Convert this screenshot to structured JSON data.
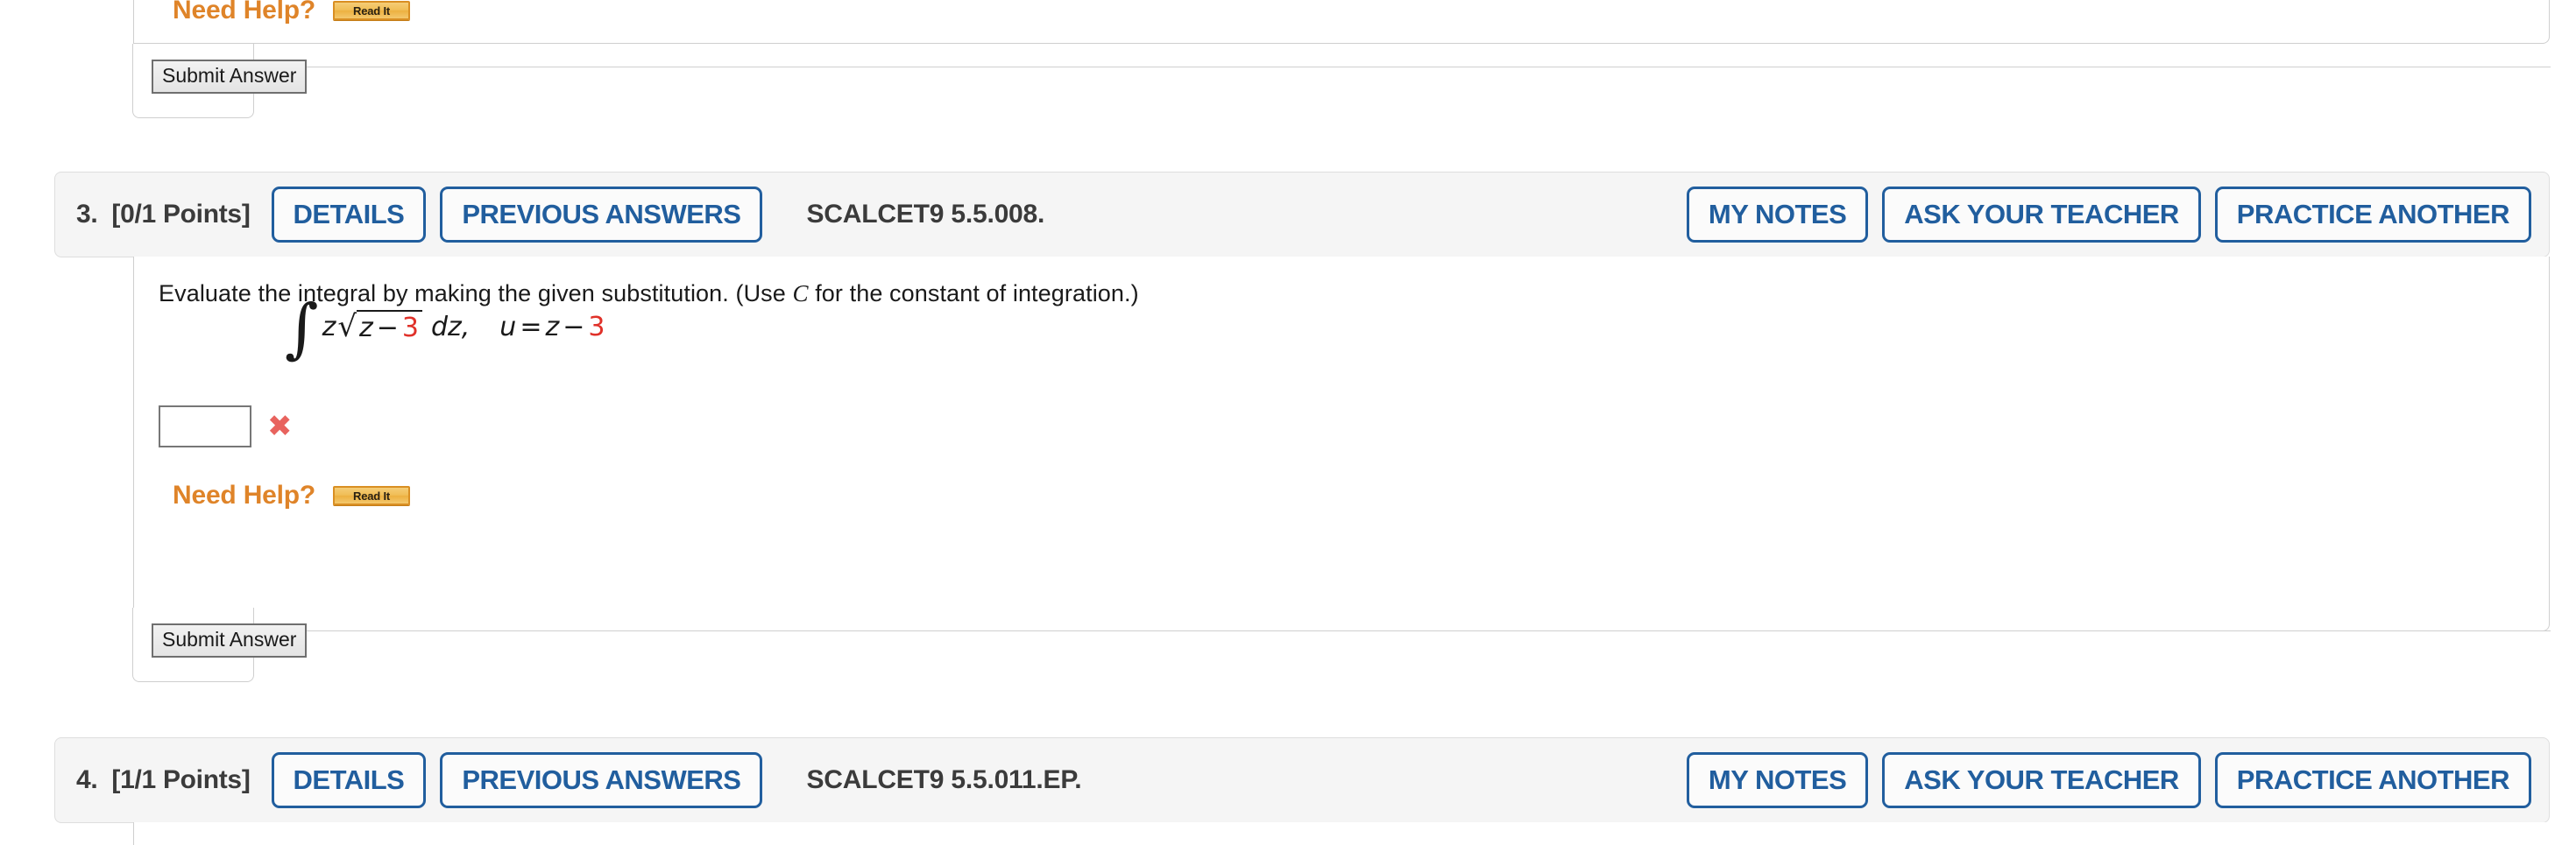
{
  "colors": {
    "accent_blue": "#215e9e",
    "orange": "#df8429",
    "red_mark": "#e8635e",
    "red_number": "#e03129",
    "header_bg": "#f5f5f5",
    "border": "#cfcfcf"
  },
  "labels": {
    "details": "DETAILS",
    "previous_answers": "PREVIOUS ANSWERS",
    "my_notes": "MY NOTES",
    "ask_your_teacher": "ASK YOUR TEACHER",
    "practice_another": "PRACTICE ANOTHER",
    "submit_answer": "Submit Answer",
    "need_help": "Need Help?",
    "read_it": "Read It",
    "incorrect_mark": "✖"
  },
  "questions": [
    {
      "id": "q2-partial",
      "need_help": "Need Help?",
      "read_it": "Read It",
      "submit_answer": "Submit Answer"
    },
    {
      "id": "q3",
      "number": "3.",
      "points": "[0/1 Points]",
      "code": "SCALCET9 5.5.008.",
      "prompt_part1": "Evaluate the integral by making the given substitution. (Use ",
      "prompt_italic": "C",
      "prompt_part2": " for the constant of integration.)",
      "math": {
        "integral_sign": "∫",
        "integrand_z": "z",
        "radical_sign": "√",
        "radicand_var": "z",
        "radicand_op": "−",
        "radicand_num": "3",
        "differential": "dz,",
        "substitution_u": "u",
        "substitution_eq": "=",
        "substitution_var": "z",
        "substitution_op": "−",
        "substitution_num": "3"
      },
      "answer_value": "",
      "answer_status": "✖",
      "need_help": "Need Help?",
      "read_it": "Read It",
      "submit_answer": "Submit Answer"
    },
    {
      "id": "q4",
      "number": "4.",
      "points": "[1/1 Points]",
      "code": "SCALCET9 5.5.011.EP."
    }
  ]
}
